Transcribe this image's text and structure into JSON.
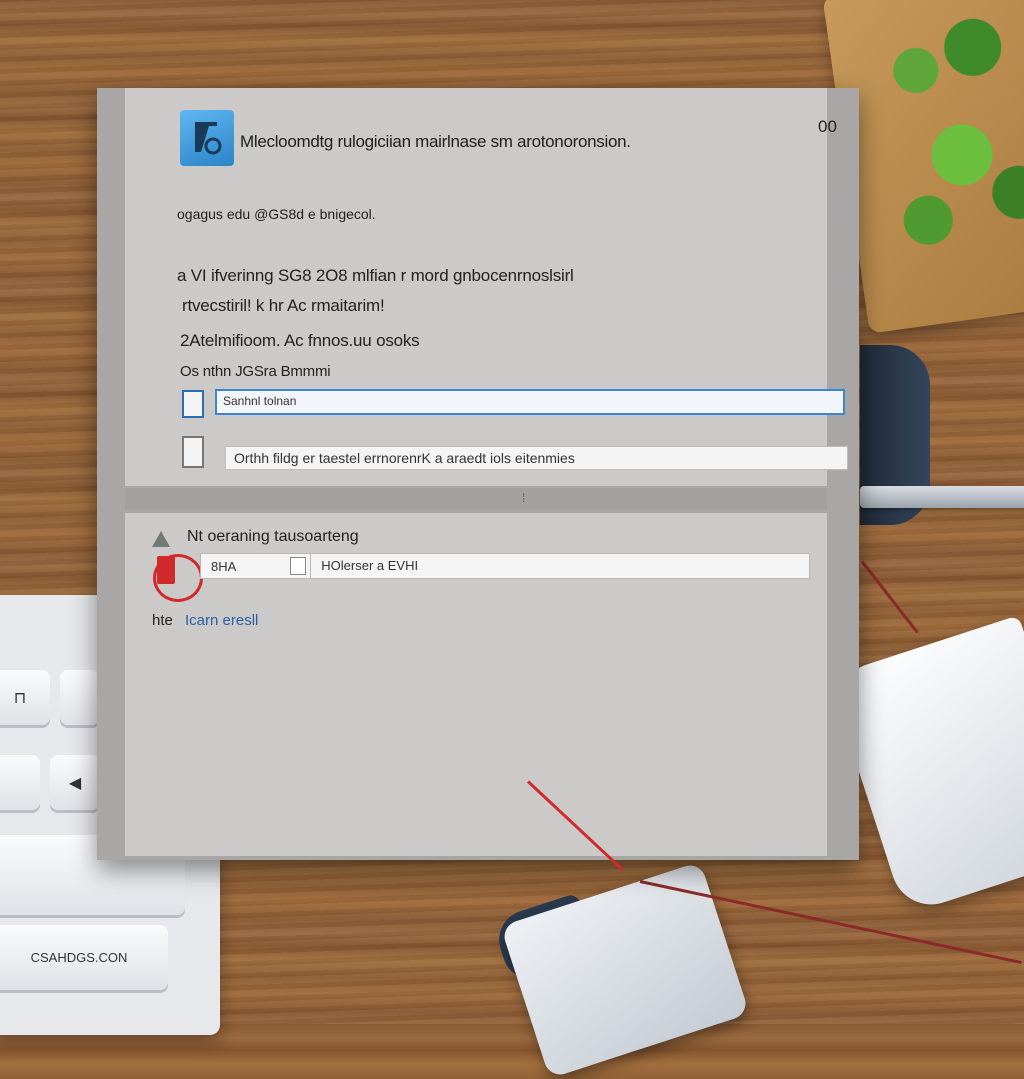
{
  "window": {
    "title": "Mlecloomdtg rulogiciian mairlnase sm arotonoronsion.",
    "corner_text": "00",
    "subtitle": "ogagus edu @GS8d e bnigecol.",
    "lines": [
      "a VI ifverinng SG8 2O8 mlfian r mord gnbocenrnoslsirl",
      "rtvecstiril! k hr Ac rmaitarim!",
      "2Atelmifioom. Ac fnnos.uu osoks",
      "Os nthn JGSra Bmmmi"
    ],
    "field_primary": "Sanhnl tolnan",
    "field_secondary": "Orthh fildg er taestel errnorenrK a araedt iols eitenmies",
    "bottom_heading": "Nt oeraning tausoarteng",
    "path_left": "8HA",
    "path_right": "HOlerser a EVHI",
    "link_label": "hte",
    "link_text": "Icarn eresll"
  },
  "keyboard": {
    "keys": [
      "⊓",
      "",
      "",
      "◀",
      "",
      "CSAHDGS.CON"
    ]
  },
  "colors": {
    "accent": "#3d86cf",
    "link": "#2a5ea8",
    "alert": "#d12a2a",
    "window_bg": "#cbcac8"
  }
}
